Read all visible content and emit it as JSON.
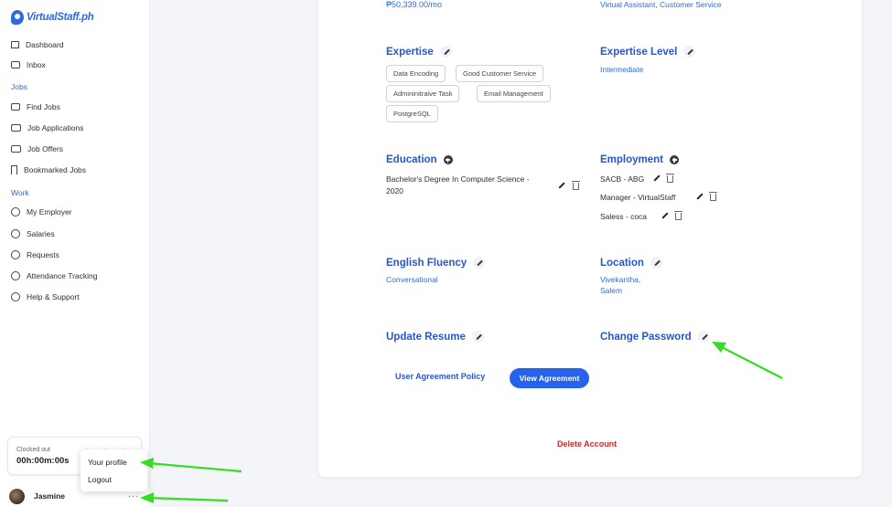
{
  "brand": {
    "logo_text": "VirtualStaff.ph",
    "color": "#2f6bd8"
  },
  "sidebar": {
    "items": [
      {
        "label": "Dashboard",
        "icon": "home-icon"
      },
      {
        "label": "Inbox",
        "icon": "inbox-icon"
      }
    ],
    "sections": [
      {
        "title": "Jobs",
        "items": [
          {
            "label": "Find Jobs",
            "icon": "briefcase-icon"
          },
          {
            "label": "Job Applications",
            "icon": "applications-icon"
          },
          {
            "label": "Job Offers",
            "icon": "offers-icon"
          },
          {
            "label": "Bookmarked Jobs",
            "icon": "bookmark-icon"
          }
        ]
      },
      {
        "title": "Work",
        "items": [
          {
            "label": "My Employer",
            "icon": "employer-icon"
          },
          {
            "label": "Salaries",
            "icon": "dollar-icon"
          },
          {
            "label": "Requests",
            "icon": "requests-icon"
          },
          {
            "label": "Attendance Tracking",
            "icon": "clock-icon"
          },
          {
            "label": "Help & Support",
            "icon": "help-icon"
          }
        ]
      }
    ],
    "clock": {
      "status": "Clocked out",
      "time": "00h:00m:00s"
    },
    "popup": {
      "profile": "Your profile",
      "logout": "Logout"
    },
    "user": {
      "name": "Jasmine",
      "more": "..."
    }
  },
  "profile": {
    "salary": "₱50,339.00/mo",
    "roles": "Virtual Assistant, Customer Service",
    "expertise": {
      "title": "Expertise",
      "chips": [
        "Data Encoding",
        "Good Customer Service",
        "Admininitraive Task",
        "Email Management",
        "PostgreSQL"
      ]
    },
    "expertise_level": {
      "title": "Expertise Level",
      "value": "Intermediate"
    },
    "education": {
      "title": "Education",
      "line1": "Bachelor's Degree In Computer Science -",
      "line2": "2020"
    },
    "employment": {
      "title": "Employment",
      "entries": [
        "SACB - ABG",
        "Manager - VirtualStaff",
        "Saless - coca"
      ]
    },
    "english": {
      "title": "English Fluency",
      "value": "Conversational"
    },
    "location": {
      "title": "Location",
      "line1": "Vivekantha,",
      "line2": "Salem"
    },
    "resume": {
      "title": "Update Resume"
    },
    "password": {
      "title": "Change Password"
    },
    "agreement": {
      "link": "User Agreement Policy",
      "button": "View Agreement"
    },
    "delete": "Delete Account"
  },
  "colors": {
    "accent": "#2563eb",
    "danger": "#d12a2a",
    "annotation_arrow": "#33dd22"
  }
}
